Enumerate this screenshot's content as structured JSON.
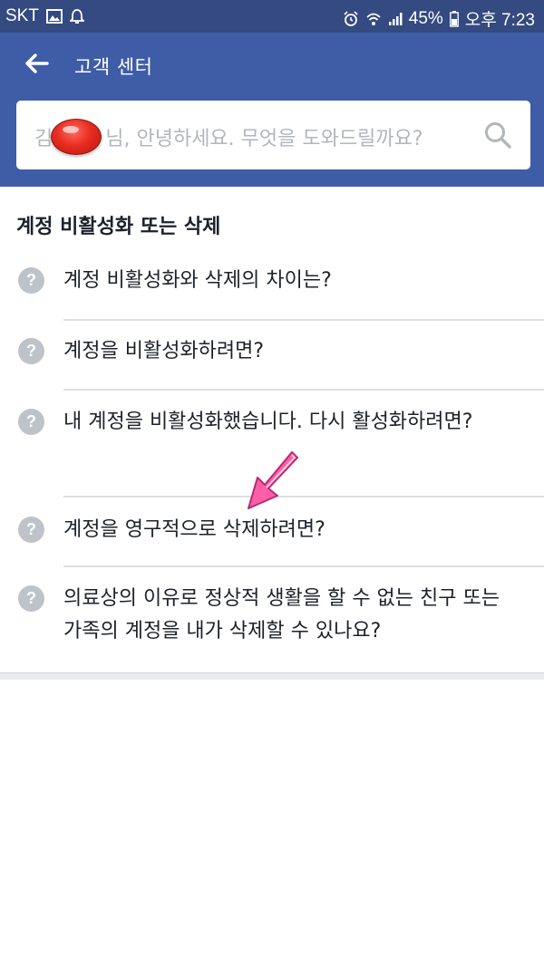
{
  "status_bar": {
    "carrier": "SKT",
    "battery": "45%",
    "time": "오후 7:23"
  },
  "header": {
    "title": "고객 센터"
  },
  "search": {
    "placeholder_prefix": "김",
    "placeholder_text": "님, 안녕하세요. 무엇을 도와드릴까요?"
  },
  "section": {
    "title": "계정 비활성화 또는 삭제",
    "items": [
      {
        "icon": "question-icon",
        "text": "계정 비활성화와 삭제의 차이는?"
      },
      {
        "icon": "question-icon",
        "text": "계정을 비활성화하려면?"
      },
      {
        "icon": "question-icon",
        "text": "내 계정을 비활성화했습니다. 다시 활성화하려면?"
      },
      {
        "icon": "question-icon",
        "text": "계정을 영구적으로 삭제하려면?"
      },
      {
        "icon": "question-icon",
        "text": "의료상의 이유로 정상적 생활을 할 수 없는 친구 또는 가족의 계정을 내가 삭제할 수 있나요?"
      }
    ]
  },
  "colors": {
    "header_bg": "#3f5ca6",
    "status_bg": "#344a80",
    "annotation_arrow": "#ff5fa8",
    "redaction": "#e72d22"
  }
}
